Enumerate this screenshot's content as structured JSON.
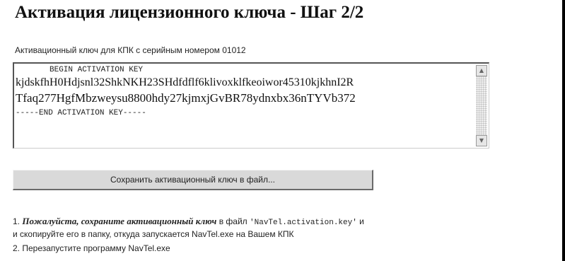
{
  "page": {
    "title": "Активация лицензионного ключа - Шаг 2/2",
    "subtitle": "Активационный ключ для КПК с серийным номером 01012"
  },
  "activation": {
    "begin_marker": "BEGIN ACTIVATION KEY",
    "key_line1": "kjdskfhH0Hdjsnl32ShkNKH23SHdfdflf6klivoxklfkeoiwor45310kjkhnI2R",
    "key_line2": "Tfaq277HgfMbzweysu8800hdy27kjmxjGvBR78ydnxbx36nTYVb372",
    "end_marker": "-----END ACTIVATION KEY-----"
  },
  "buttons": {
    "save_label": "Сохранить активационный ключ в файл..."
  },
  "instructions": {
    "line1_num": "1.",
    "line1_emph": "Пожалуйста, сохраните активационный ключ",
    "line1_rest": " в файл ",
    "line1_filename": "'NavTel.activation.key'",
    "line1_tail": " и",
    "line2": "и скопируйте его в папку, откуда запускается NavTel.exe на Вашем КПК",
    "line3": "2. Перезапустите программу NavTel.exe"
  }
}
